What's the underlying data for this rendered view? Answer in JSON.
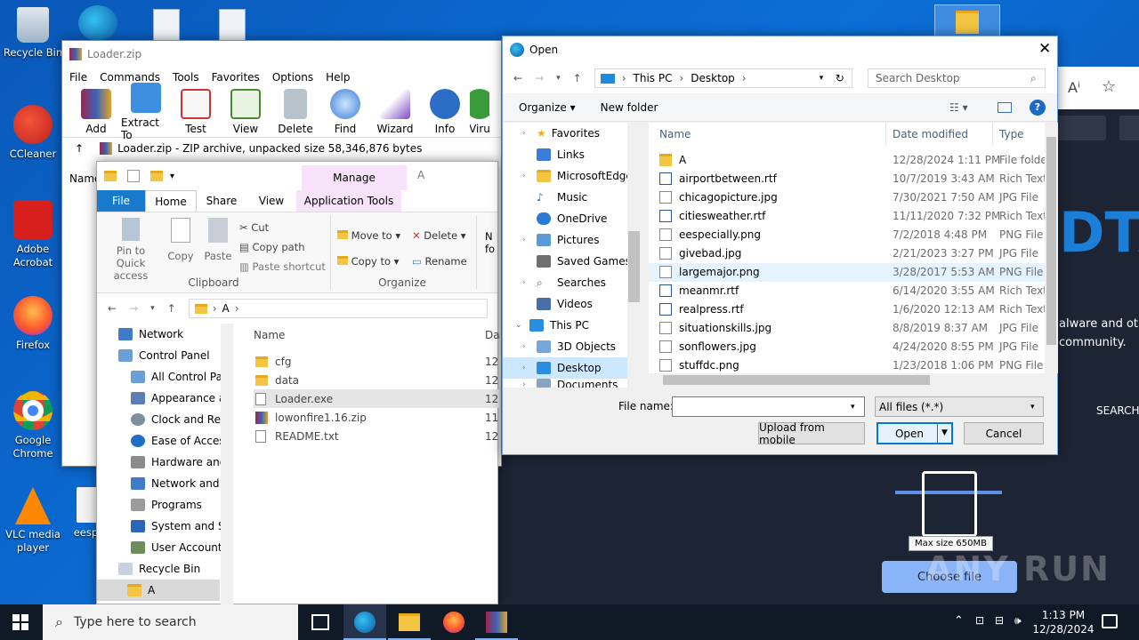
{
  "desktop": {
    "icons": [
      {
        "label": "Recycle Bin"
      },
      {
        "label": "CCleaner"
      },
      {
        "label": "Adobe Acrobat"
      },
      {
        "label": "Firefox"
      },
      {
        "label": "Google Chrome"
      },
      {
        "label": "VLC media player"
      },
      {
        "label": "eespe"
      }
    ]
  },
  "winrar": {
    "title": "Loader.zip",
    "menu": [
      "File",
      "Commands",
      "Tools",
      "Favorites",
      "Options",
      "Help"
    ],
    "toolbar": [
      "Add",
      "Extract To",
      "Test",
      "View",
      "Delete",
      "Find",
      "Wizard",
      "Info",
      "Viru"
    ],
    "path": "Loader.zip - ZIP archive, unpacked size 58,346,876 bytes",
    "col_name": "Name"
  },
  "explorer": {
    "manage_label": "Manage",
    "window_title": "A",
    "tabs": [
      "File",
      "Home",
      "Share",
      "View",
      "Application Tools"
    ],
    "clipboard": {
      "pin": "Pin to Quick access",
      "copy": "Copy",
      "paste": "Paste",
      "cut": "Cut",
      "copy_path": "Copy path",
      "paste_shortcut": "Paste shortcut",
      "group": "Clipboard"
    },
    "organize": {
      "move_to": "Move to",
      "copy_to": "Copy to",
      "delete": "Delete",
      "rename": "Rename",
      "group": "Organize"
    },
    "new_partial": "N fo",
    "address": "A",
    "nav": [
      "Network",
      "Control Panel",
      "All Control Par",
      "Appearance an",
      "Clock and Regi",
      "Ease of Access",
      "Hardware and",
      "Network and Ir",
      "Programs",
      "System and Se",
      "User Accounts",
      "Recycle Bin",
      "A"
    ],
    "col_name": "Name",
    "col_date": "Da",
    "files": [
      {
        "name": "cfg",
        "date": "12"
      },
      {
        "name": "data",
        "date": "12"
      },
      {
        "name": "Loader.exe",
        "date": "12"
      },
      {
        "name": "lowonfire1.16.zip",
        "date": "11"
      },
      {
        "name": "README.txt",
        "date": "12"
      }
    ]
  },
  "dialog": {
    "title": "Open",
    "crumbs": [
      "This PC",
      "Desktop"
    ],
    "search_placeholder": "Search Desktop",
    "organize": "Organize",
    "new_folder": "New folder",
    "tree": [
      "Favorites",
      "Links",
      "MicrosoftEdge",
      "Music",
      "OneDrive",
      "Pictures",
      "Saved Games",
      "Searches",
      "Videos",
      "This PC",
      "3D Objects",
      "Desktop",
      "Documents"
    ],
    "headers": {
      "name": "Name",
      "date": "Date modified",
      "type": "Type"
    },
    "files": [
      {
        "name": "A",
        "date": "12/28/2024 1:11 PM",
        "type": "File folde"
      },
      {
        "name": "airportbetween.rtf",
        "date": "10/7/2019 3:43 AM",
        "type": "Rich Text"
      },
      {
        "name": "chicagopicture.jpg",
        "date": "7/30/2021 7:50 AM",
        "type": "JPG File"
      },
      {
        "name": "citiesweather.rtf",
        "date": "11/11/2020 7:32 PM",
        "type": "Rich Text"
      },
      {
        "name": "eespecially.png",
        "date": "7/2/2018 4:48 PM",
        "type": "PNG File"
      },
      {
        "name": "givebad.jpg",
        "date": "2/21/2023 3:27 PM",
        "type": "JPG File"
      },
      {
        "name": "largemajor.png",
        "date": "3/28/2017 5:53 AM",
        "type": "PNG File"
      },
      {
        "name": "meanmr.rtf",
        "date": "6/14/2020 3:55 AM",
        "type": "Rich Text"
      },
      {
        "name": "realpress.rtf",
        "date": "1/6/2020 12:13 AM",
        "type": "Rich Text"
      },
      {
        "name": "situationskills.jpg",
        "date": "8/8/2019 8:37 AM",
        "type": "JPG File"
      },
      {
        "name": "sonflowers.jpg",
        "date": "4/24/2020 8:55 PM",
        "type": "JPG File"
      },
      {
        "name": "stuffdc.png",
        "date": "1/23/2018 1:06 PM",
        "type": "PNG File"
      }
    ],
    "file_name_label": "File name:",
    "file_name_value": "",
    "filter": "All files (*.*)",
    "upload": "Upload from mobile",
    "open": "Open",
    "cancel": "Cancel"
  },
  "browser": {
    "big_text": "DTA",
    "text1": "alware and oth",
    "text2": "community.",
    "search": "SEARCH",
    "max_size": "Max size 650MB",
    "choose": "Choose file",
    "watermark": "ANY RUN"
  },
  "taskbar": {
    "search_placeholder": "Type here to search",
    "time": "1:13 PM",
    "date": "12/28/2024"
  },
  "colors": {
    "accent": "#0078d7",
    "selected": "#cce8ff",
    "manage_tab": "#f6e3f9"
  }
}
